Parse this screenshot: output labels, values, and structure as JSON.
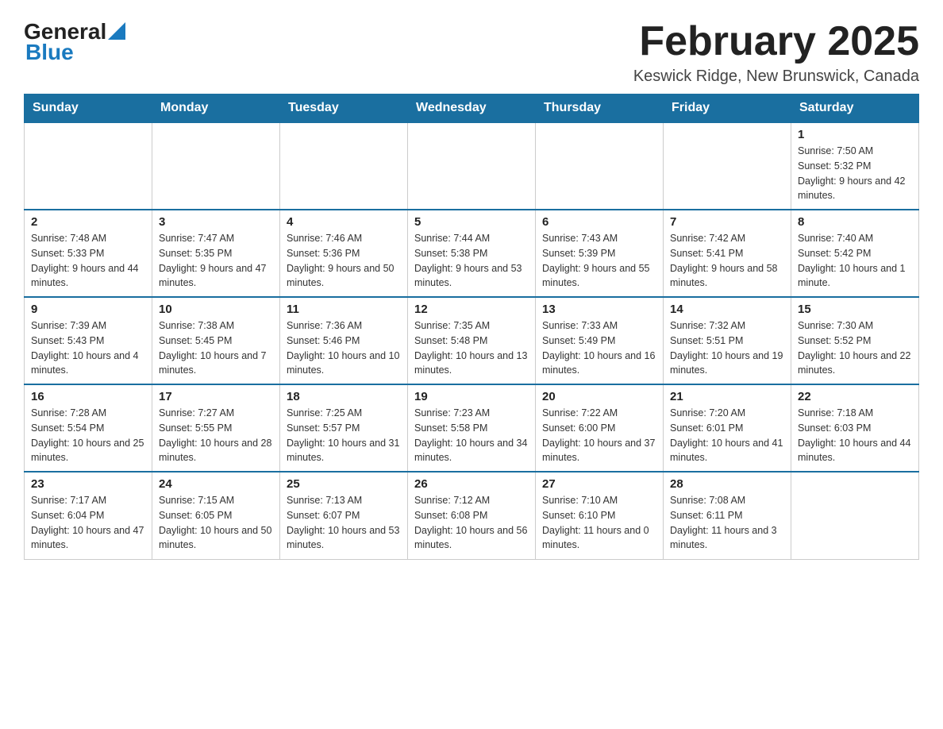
{
  "header": {
    "logo_general": "General",
    "logo_blue": "Blue",
    "month_title": "February 2025",
    "location": "Keswick Ridge, New Brunswick, Canada"
  },
  "days_of_week": [
    "Sunday",
    "Monday",
    "Tuesday",
    "Wednesday",
    "Thursday",
    "Friday",
    "Saturday"
  ],
  "weeks": [
    [
      {
        "day": "",
        "info": ""
      },
      {
        "day": "",
        "info": ""
      },
      {
        "day": "",
        "info": ""
      },
      {
        "day": "",
        "info": ""
      },
      {
        "day": "",
        "info": ""
      },
      {
        "day": "",
        "info": ""
      },
      {
        "day": "1",
        "info": "Sunrise: 7:50 AM\nSunset: 5:32 PM\nDaylight: 9 hours and 42 minutes."
      }
    ],
    [
      {
        "day": "2",
        "info": "Sunrise: 7:48 AM\nSunset: 5:33 PM\nDaylight: 9 hours and 44 minutes."
      },
      {
        "day": "3",
        "info": "Sunrise: 7:47 AM\nSunset: 5:35 PM\nDaylight: 9 hours and 47 minutes."
      },
      {
        "day": "4",
        "info": "Sunrise: 7:46 AM\nSunset: 5:36 PM\nDaylight: 9 hours and 50 minutes."
      },
      {
        "day": "5",
        "info": "Sunrise: 7:44 AM\nSunset: 5:38 PM\nDaylight: 9 hours and 53 minutes."
      },
      {
        "day": "6",
        "info": "Sunrise: 7:43 AM\nSunset: 5:39 PM\nDaylight: 9 hours and 55 minutes."
      },
      {
        "day": "7",
        "info": "Sunrise: 7:42 AM\nSunset: 5:41 PM\nDaylight: 9 hours and 58 minutes."
      },
      {
        "day": "8",
        "info": "Sunrise: 7:40 AM\nSunset: 5:42 PM\nDaylight: 10 hours and 1 minute."
      }
    ],
    [
      {
        "day": "9",
        "info": "Sunrise: 7:39 AM\nSunset: 5:43 PM\nDaylight: 10 hours and 4 minutes."
      },
      {
        "day": "10",
        "info": "Sunrise: 7:38 AM\nSunset: 5:45 PM\nDaylight: 10 hours and 7 minutes."
      },
      {
        "day": "11",
        "info": "Sunrise: 7:36 AM\nSunset: 5:46 PM\nDaylight: 10 hours and 10 minutes."
      },
      {
        "day": "12",
        "info": "Sunrise: 7:35 AM\nSunset: 5:48 PM\nDaylight: 10 hours and 13 minutes."
      },
      {
        "day": "13",
        "info": "Sunrise: 7:33 AM\nSunset: 5:49 PM\nDaylight: 10 hours and 16 minutes."
      },
      {
        "day": "14",
        "info": "Sunrise: 7:32 AM\nSunset: 5:51 PM\nDaylight: 10 hours and 19 minutes."
      },
      {
        "day": "15",
        "info": "Sunrise: 7:30 AM\nSunset: 5:52 PM\nDaylight: 10 hours and 22 minutes."
      }
    ],
    [
      {
        "day": "16",
        "info": "Sunrise: 7:28 AM\nSunset: 5:54 PM\nDaylight: 10 hours and 25 minutes."
      },
      {
        "day": "17",
        "info": "Sunrise: 7:27 AM\nSunset: 5:55 PM\nDaylight: 10 hours and 28 minutes."
      },
      {
        "day": "18",
        "info": "Sunrise: 7:25 AM\nSunset: 5:57 PM\nDaylight: 10 hours and 31 minutes."
      },
      {
        "day": "19",
        "info": "Sunrise: 7:23 AM\nSunset: 5:58 PM\nDaylight: 10 hours and 34 minutes."
      },
      {
        "day": "20",
        "info": "Sunrise: 7:22 AM\nSunset: 6:00 PM\nDaylight: 10 hours and 37 minutes."
      },
      {
        "day": "21",
        "info": "Sunrise: 7:20 AM\nSunset: 6:01 PM\nDaylight: 10 hours and 41 minutes."
      },
      {
        "day": "22",
        "info": "Sunrise: 7:18 AM\nSunset: 6:03 PM\nDaylight: 10 hours and 44 minutes."
      }
    ],
    [
      {
        "day": "23",
        "info": "Sunrise: 7:17 AM\nSunset: 6:04 PM\nDaylight: 10 hours and 47 minutes."
      },
      {
        "day": "24",
        "info": "Sunrise: 7:15 AM\nSunset: 6:05 PM\nDaylight: 10 hours and 50 minutes."
      },
      {
        "day": "25",
        "info": "Sunrise: 7:13 AM\nSunset: 6:07 PM\nDaylight: 10 hours and 53 minutes."
      },
      {
        "day": "26",
        "info": "Sunrise: 7:12 AM\nSunset: 6:08 PM\nDaylight: 10 hours and 56 minutes."
      },
      {
        "day": "27",
        "info": "Sunrise: 7:10 AM\nSunset: 6:10 PM\nDaylight: 11 hours and 0 minutes."
      },
      {
        "day": "28",
        "info": "Sunrise: 7:08 AM\nSunset: 6:11 PM\nDaylight: 11 hours and 3 minutes."
      },
      {
        "day": "",
        "info": ""
      }
    ]
  ]
}
